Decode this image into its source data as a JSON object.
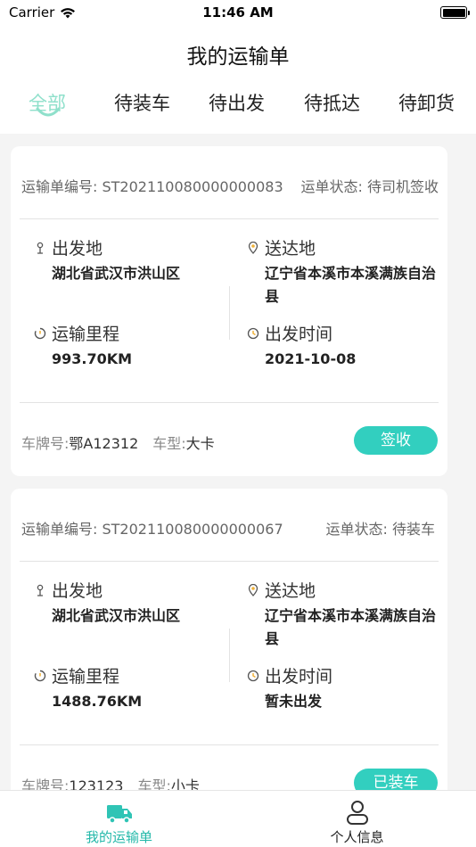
{
  "status_bar": {
    "carrier": "Carrier",
    "time": "11:46 AM"
  },
  "nav": {
    "title": "我的运输单"
  },
  "tabs": [
    {
      "label": "全部",
      "active": true
    },
    {
      "label": "待装车"
    },
    {
      "label": "待出发"
    },
    {
      "label": "待抵达"
    },
    {
      "label": "待卸货"
    }
  ],
  "orders": [
    {
      "number_label": "运输单编号: ST202110080000000083",
      "status_label": "运单状态: 待司机签收",
      "origin_label": "出发地",
      "origin_value": "湖北省武汉市洪山区",
      "dest_label": "送达地",
      "dest_value": "辽宁省本溪市本溪满族自治县",
      "distance_label": "运输里程",
      "distance_value": "993.70KM",
      "depart_label": "出发时间",
      "depart_value": "2021-10-08",
      "plate_label": "车牌号:",
      "plate_value": "鄂A12312",
      "type_label": "车型:",
      "type_value": "大卡",
      "action_label": "签收"
    },
    {
      "number_label": "运输单编号: ST202110080000000067",
      "status_label": "运单状态: 待装车",
      "origin_label": "出发地",
      "origin_value": "湖北省武汉市洪山区",
      "dest_label": "送达地",
      "dest_value": "辽宁省本溪市本溪满族自治县",
      "distance_label": "运输里程",
      "distance_value": "1488.76KM",
      "depart_label": "出发时间",
      "depart_value": "暂未出发",
      "plate_label": "车牌号:",
      "plate_value": "123123",
      "type_label": "车型:",
      "type_value": "小卡",
      "action_label": "已装车"
    }
  ],
  "tabbar": [
    {
      "label": "我的运输单",
      "icon": "truck-icon",
      "active": true
    },
    {
      "label": "个人信息",
      "icon": "person-icon"
    }
  ],
  "colors": {
    "accent": "#32cfbf",
    "tab_active": "#8fe0cb",
    "tabbar_active": "#23b8a9"
  }
}
